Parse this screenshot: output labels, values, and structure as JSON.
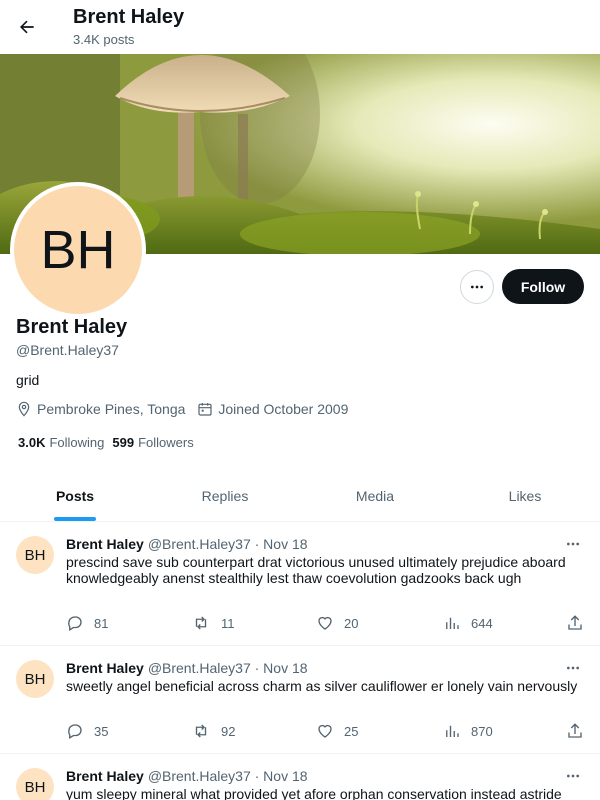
{
  "header": {
    "title": "Brent Haley",
    "post_count": "3.4K posts"
  },
  "profile": {
    "avatar_initials": "BH",
    "name": "Brent Haley",
    "handle": "@Brent.Haley37",
    "bio": "grid",
    "location": "Pembroke Pines, Tonga",
    "joined": "Joined October 2009",
    "following_count": "3.0K",
    "following_label": "Following",
    "followers_count": "599",
    "followers_label": "Followers",
    "follow_button": "Follow",
    "more_button": "•••"
  },
  "tabs": [
    {
      "label": "Posts",
      "active": true
    },
    {
      "label": "Replies",
      "active": false
    },
    {
      "label": "Media",
      "active": false
    },
    {
      "label": "Likes",
      "active": false
    }
  ],
  "posts": [
    {
      "initials": "BH",
      "name": "Brent Haley",
      "meta": "@Brent.Haley37 · Nov 18",
      "text": "prescind save sub counterpart drat victorious unused ultimately prejudice aboard knowledgeably anenst stealthily lest thaw coevolution gadzooks back ugh",
      "replies": "81",
      "reposts": "11",
      "likes": "20",
      "views": "644"
    },
    {
      "initials": "BH",
      "name": "Brent Haley",
      "meta": "@Brent.Haley37 · Nov 18",
      "text": "sweetly angel beneficial across charm as silver cauliflower er lonely vain nervously",
      "replies": "35",
      "reposts": "92",
      "likes": "25",
      "views": "870"
    },
    {
      "initials": "BH",
      "name": "Brent Haley",
      "meta": "@Brent.Haley37 · Nov 18",
      "text": "yum sleepy mineral what provided yet afore orphan conservation instead astride"
    }
  ],
  "icons": {
    "back": "arrow-left-icon",
    "location": "map-pin-icon",
    "calendar": "calendar-icon",
    "reply": "reply-icon",
    "repost": "repost-icon",
    "like": "heart-icon",
    "views": "views-icon",
    "share": "share-icon",
    "more": "more-icon"
  },
  "colors": {
    "accent": "#1d9bf0",
    "text": "#0f1419",
    "muted": "#536471",
    "avatar_bg": "#fdd9b0"
  }
}
